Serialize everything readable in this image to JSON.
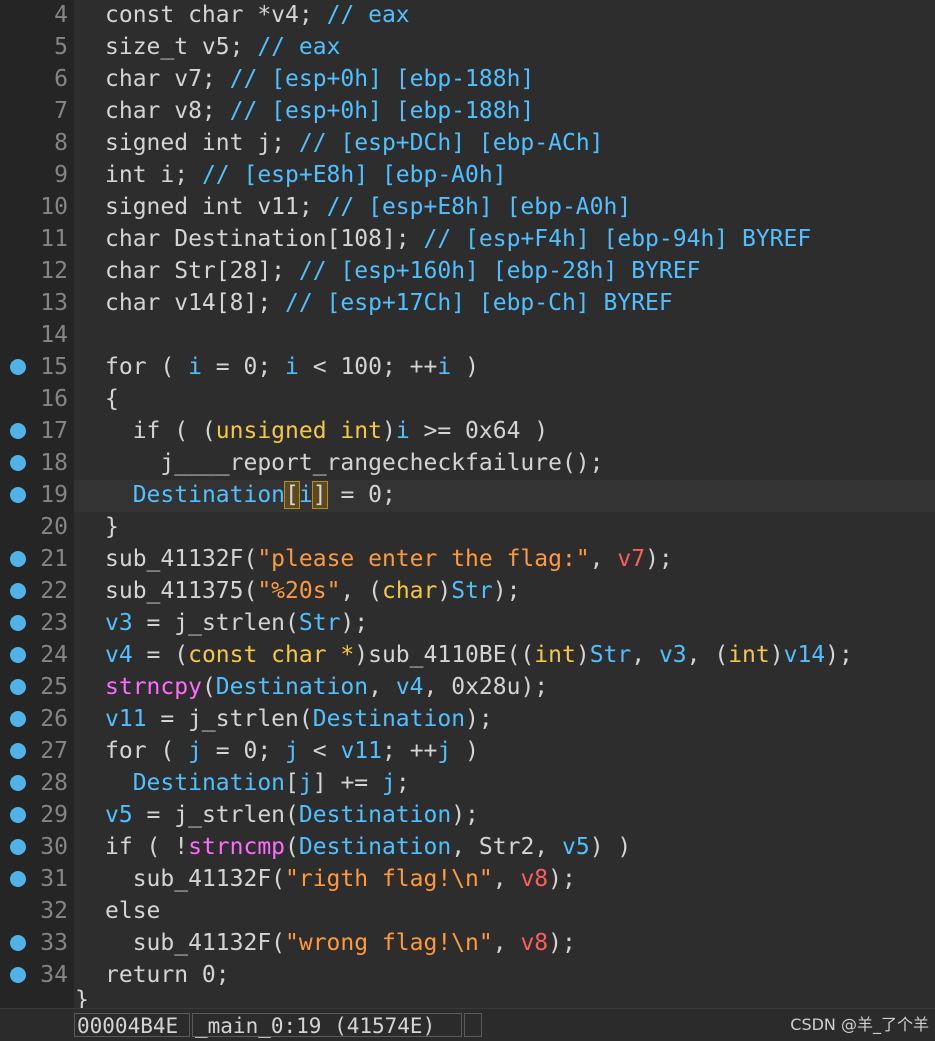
{
  "editor": {
    "lines": [
      {
        "no": "4",
        "bp": false,
        "tokens": [
          [
            "kw",
            "const char *v4; "
          ],
          [
            "cm",
            "// eax"
          ]
        ]
      },
      {
        "no": "5",
        "bp": false,
        "tokens": [
          [
            "kw",
            "size_t v5; "
          ],
          [
            "cm",
            "// eax"
          ]
        ]
      },
      {
        "no": "6",
        "bp": false,
        "tokens": [
          [
            "kw",
            "char v7; "
          ],
          [
            "cm",
            "// [esp+0h] [ebp-188h]"
          ]
        ]
      },
      {
        "no": "7",
        "bp": false,
        "tokens": [
          [
            "kw",
            "char v8; "
          ],
          [
            "cm",
            "// [esp+0h] [ebp-188h]"
          ]
        ]
      },
      {
        "no": "8",
        "bp": false,
        "tokens": [
          [
            "kw",
            "signed int j; "
          ],
          [
            "cm",
            "// [esp+DCh] [ebp-ACh]"
          ]
        ]
      },
      {
        "no": "9",
        "bp": false,
        "tokens": [
          [
            "kw",
            "int i; "
          ],
          [
            "cm",
            "// [esp+E8h] [ebp-A0h]"
          ]
        ]
      },
      {
        "no": "10",
        "bp": false,
        "tokens": [
          [
            "kw",
            "signed int v11; "
          ],
          [
            "cm",
            "// [esp+E8h] [ebp-A0h]"
          ]
        ]
      },
      {
        "no": "11",
        "bp": false,
        "tokens": [
          [
            "kw",
            "char Destination[108]; "
          ],
          [
            "cm",
            "// [esp+F4h] [ebp-94h] BYREF"
          ]
        ]
      },
      {
        "no": "12",
        "bp": false,
        "tokens": [
          [
            "kw",
            "char Str[28]; "
          ],
          [
            "cm",
            "// [esp+160h] [ebp-28h] BYREF"
          ]
        ]
      },
      {
        "no": "13",
        "bp": false,
        "tokens": [
          [
            "kw",
            "char v14[8]; "
          ],
          [
            "cm",
            "// [esp+17Ch] [ebp-Ch] BYREF"
          ]
        ]
      },
      {
        "no": "14",
        "bp": false,
        "tokens": []
      },
      {
        "no": "15",
        "bp": true,
        "tokens": [
          [
            "kw",
            "for ( "
          ],
          [
            "var",
            "i"
          ],
          [
            "kw",
            " = 0; "
          ],
          [
            "var",
            "i"
          ],
          [
            "kw",
            " < 100; ++"
          ],
          [
            "var",
            "i"
          ],
          [
            "kw",
            " )"
          ]
        ]
      },
      {
        "no": "16",
        "bp": false,
        "tokens": [
          [
            "kw",
            "{"
          ]
        ]
      },
      {
        "no": "17",
        "bp": true,
        "tokens": [
          [
            "kw",
            "  if ( ("
          ],
          [
            "typ",
            "unsigned int"
          ],
          [
            "kw",
            ")"
          ],
          [
            "var",
            "i"
          ],
          [
            "kw",
            " >= 0x64 )"
          ]
        ]
      },
      {
        "no": "18",
        "bp": true,
        "tokens": [
          [
            "kw",
            "    j____report_rangecheckfailure();"
          ]
        ]
      },
      {
        "no": "19",
        "bp": true,
        "current": true,
        "tokens": [
          [
            "kw",
            "  "
          ],
          [
            "dst",
            "Destination"
          ],
          [
            "hl",
            "["
          ],
          [
            "var",
            "i"
          ],
          [
            "hl",
            "]"
          ],
          [
            "kw",
            " = 0;"
          ]
        ]
      },
      {
        "no": "20",
        "bp": false,
        "tokens": [
          [
            "kw",
            "}"
          ]
        ]
      },
      {
        "no": "21",
        "bp": true,
        "tokens": [
          [
            "kw",
            "sub_41132F("
          ],
          [
            "str",
            "\"please enter the flag:\""
          ],
          [
            "kw",
            ", "
          ],
          [
            "arg",
            "v7"
          ],
          [
            "kw",
            ");"
          ]
        ]
      },
      {
        "no": "22",
        "bp": true,
        "tokens": [
          [
            "kw",
            "sub_411375("
          ],
          [
            "str",
            "\"%20s\""
          ],
          [
            "kw",
            ", ("
          ],
          [
            "typ",
            "char"
          ],
          [
            "kw",
            ")"
          ],
          [
            "dst",
            "Str"
          ],
          [
            "kw",
            ");"
          ]
        ]
      },
      {
        "no": "23",
        "bp": true,
        "tokens": [
          [
            "var",
            "v3"
          ],
          [
            "kw",
            " = j_strlen("
          ],
          [
            "dst",
            "Str"
          ],
          [
            "kw",
            ");"
          ]
        ]
      },
      {
        "no": "24",
        "bp": true,
        "tokens": [
          [
            "var",
            "v4"
          ],
          [
            "kw",
            " = ("
          ],
          [
            "typ",
            "const char *"
          ],
          [
            "kw",
            ")sub_4110BE(("
          ],
          [
            "typ",
            "int"
          ],
          [
            "kw",
            ")"
          ],
          [
            "dst",
            "Str"
          ],
          [
            "kw",
            ", "
          ],
          [
            "var",
            "v3"
          ],
          [
            "kw",
            ", ("
          ],
          [
            "typ",
            "int"
          ],
          [
            "kw",
            ")"
          ],
          [
            "var",
            "v14"
          ],
          [
            "kw",
            ");"
          ]
        ]
      },
      {
        "no": "25",
        "bp": true,
        "tokens": [
          [
            "imp",
            "strncpy"
          ],
          [
            "kw",
            "("
          ],
          [
            "dst",
            "Destination"
          ],
          [
            "kw",
            ", "
          ],
          [
            "var",
            "v4"
          ],
          [
            "kw",
            ", 0x28u);"
          ]
        ]
      },
      {
        "no": "26",
        "bp": true,
        "tokens": [
          [
            "var",
            "v11"
          ],
          [
            "kw",
            " = j_strlen("
          ],
          [
            "dst",
            "Destination"
          ],
          [
            "kw",
            ");"
          ]
        ]
      },
      {
        "no": "27",
        "bp": true,
        "tokens": [
          [
            "kw",
            "for ( "
          ],
          [
            "var",
            "j"
          ],
          [
            "kw",
            " = 0; "
          ],
          [
            "var",
            "j"
          ],
          [
            "kw",
            " < "
          ],
          [
            "var",
            "v11"
          ],
          [
            "kw",
            "; ++"
          ],
          [
            "var",
            "j"
          ],
          [
            "kw",
            " )"
          ]
        ]
      },
      {
        "no": "28",
        "bp": true,
        "tokens": [
          [
            "kw",
            "  "
          ],
          [
            "dst",
            "Destination"
          ],
          [
            "kw",
            "["
          ],
          [
            "var",
            "j"
          ],
          [
            "kw",
            "] += "
          ],
          [
            "var",
            "j"
          ],
          [
            "kw",
            ";"
          ]
        ]
      },
      {
        "no": "29",
        "bp": true,
        "tokens": [
          [
            "var",
            "v5"
          ],
          [
            "kw",
            " = j_strlen("
          ],
          [
            "dst",
            "Destination"
          ],
          [
            "kw",
            ");"
          ]
        ]
      },
      {
        "no": "30",
        "bp": true,
        "tokens": [
          [
            "kw",
            "if ( !"
          ],
          [
            "imp",
            "strncmp"
          ],
          [
            "kw",
            "("
          ],
          [
            "dst",
            "Destination"
          ],
          [
            "kw",
            ", Str2, "
          ],
          [
            "var",
            "v5"
          ],
          [
            "kw",
            ") )"
          ]
        ]
      },
      {
        "no": "31",
        "bp": true,
        "tokens": [
          [
            "kw",
            "  sub_41132F("
          ],
          [
            "str",
            "\"rigth flag!\\n\""
          ],
          [
            "kw",
            ", "
          ],
          [
            "arg",
            "v8"
          ],
          [
            "kw",
            ");"
          ]
        ]
      },
      {
        "no": "32",
        "bp": false,
        "tokens": [
          [
            "kw",
            "else"
          ]
        ]
      },
      {
        "no": "33",
        "bp": true,
        "tokens": [
          [
            "kw",
            "  sub_41132F("
          ],
          [
            "str",
            "\"wrong flag!\\n\""
          ],
          [
            "kw",
            ", "
          ],
          [
            "arg",
            "v8"
          ],
          [
            "kw",
            ");"
          ]
        ]
      },
      {
        "no": "34",
        "bp": true,
        "tokens": [
          [
            "kw",
            "return 0;"
          ]
        ]
      }
    ],
    "closing_brace": "}"
  },
  "statusbar": {
    "address": "00004B4E",
    "function": "_main_0:19 (41574E)",
    "empty": ""
  },
  "watermark": "CSDN @羊_了个羊"
}
